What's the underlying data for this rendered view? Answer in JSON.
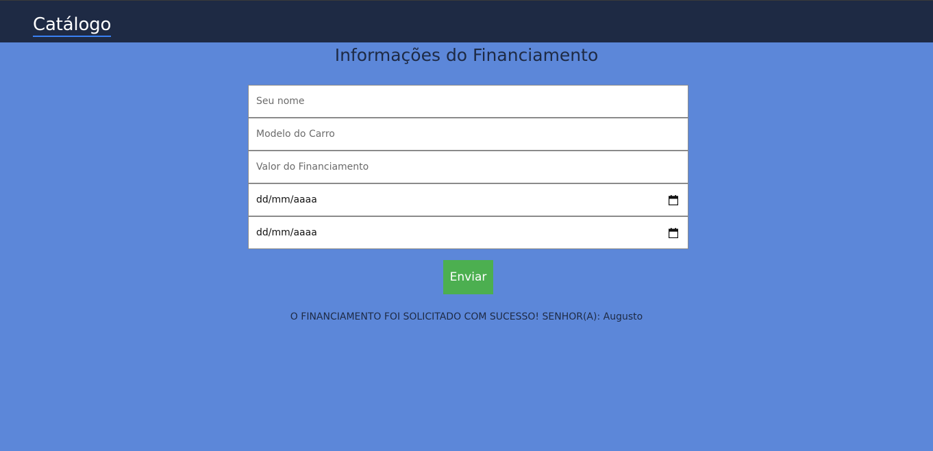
{
  "nav": {
    "brand": "Catálogo"
  },
  "main": {
    "title": "Informações do Financiamento",
    "fields": {
      "name_placeholder": "Seu nome",
      "model_placeholder": "Modelo do Carro",
      "value_placeholder": "Valor do Financiamento",
      "date1_display": "dd/mm/aaaa",
      "date2_display": "dd/mm/aaaa"
    },
    "submit_label": "Enviar",
    "status_message": "O FINANCIAMENTO FOI SOLICITADO COM SUCESSO! SENHOR(A): Augusto"
  },
  "colors": {
    "page_background": "#5c87d9",
    "navbar": "#1e2a44",
    "submit_button": "#4caf50"
  },
  "icons": {
    "date_picker": "calendar-icon"
  }
}
